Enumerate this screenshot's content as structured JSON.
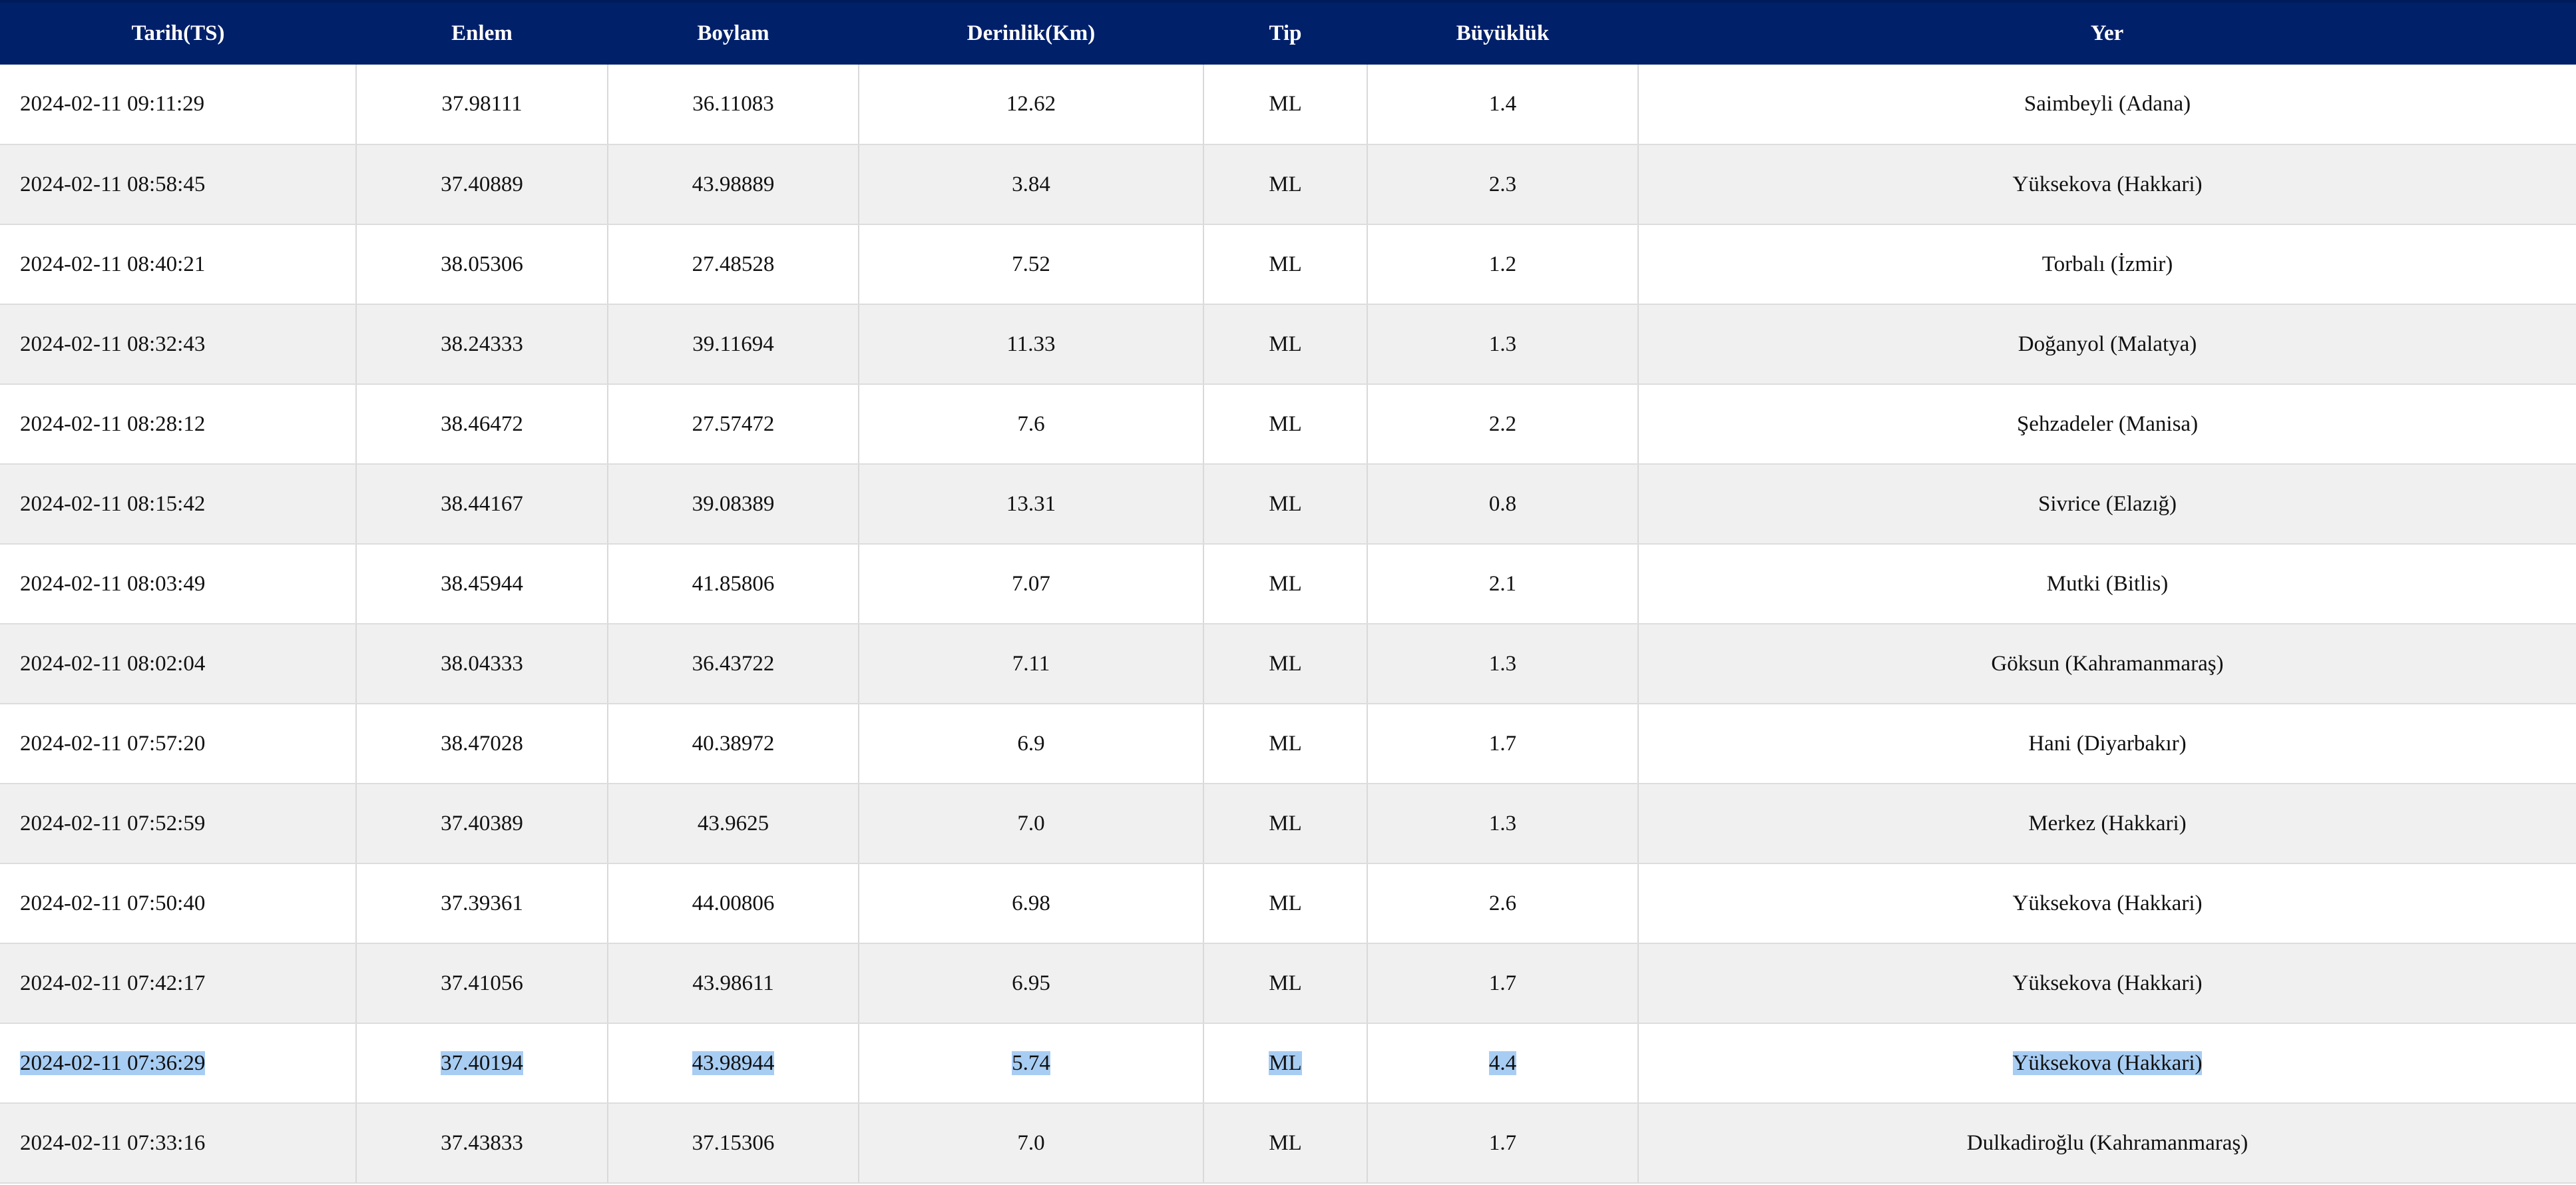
{
  "table": {
    "headers": [
      "Tarih(TS)",
      "Enlem",
      "Boylam",
      "Derinlik(Km)",
      "Tip",
      "Büyüklük",
      "Yer"
    ],
    "rows": [
      [
        "2024-02-11 09:11:29",
        "37.98111",
        "36.11083",
        "12.62",
        "ML",
        "1.4",
        "Saimbeyli (Adana)"
      ],
      [
        "2024-02-11 08:58:45",
        "37.40889",
        "43.98889",
        "3.84",
        "ML",
        "2.3",
        "Yüksekova (Hakkari)"
      ],
      [
        "2024-02-11 08:40:21",
        "38.05306",
        "27.48528",
        "7.52",
        "ML",
        "1.2",
        "Torbalı (İzmir)"
      ],
      [
        "2024-02-11 08:32:43",
        "38.24333",
        "39.11694",
        "11.33",
        "ML",
        "1.3",
        "Doğanyol (Malatya)"
      ],
      [
        "2024-02-11 08:28:12",
        "38.46472",
        "27.57472",
        "7.6",
        "ML",
        "2.2",
        "Şehzadeler (Manisa)"
      ],
      [
        "2024-02-11 08:15:42",
        "38.44167",
        "39.08389",
        "13.31",
        "ML",
        "0.8",
        "Sivrice (Elazığ)"
      ],
      [
        "2024-02-11 08:03:49",
        "38.45944",
        "41.85806",
        "7.07",
        "ML",
        "2.1",
        "Mutki (Bitlis)"
      ],
      [
        "2024-02-11 08:02:04",
        "38.04333",
        "36.43722",
        "7.11",
        "ML",
        "1.3",
        "Göksun (Kahramanmaraş)"
      ],
      [
        "2024-02-11 07:57:20",
        "38.47028",
        "40.38972",
        "6.9",
        "ML",
        "1.7",
        "Hani (Diyarbakır)"
      ],
      [
        "2024-02-11 07:52:59",
        "37.40389",
        "43.9625",
        "7.0",
        "ML",
        "1.3",
        "Merkez (Hakkari)"
      ],
      [
        "2024-02-11 07:50:40",
        "37.39361",
        "44.00806",
        "6.98",
        "ML",
        "2.6",
        "Yüksekova (Hakkari)"
      ],
      [
        "2024-02-11 07:42:17",
        "37.41056",
        "43.98611",
        "6.95",
        "ML",
        "1.7",
        "Yüksekova (Hakkari)"
      ],
      [
        "2024-02-11 07:36:29",
        "37.40194",
        "43.98944",
        "5.74",
        "ML",
        "4.4",
        "Yüksekova (Hakkari)"
      ],
      [
        "2024-02-11 07:33:16",
        "37.43833",
        "37.15306",
        "7.0",
        "ML",
        "1.7",
        "Dulkadiroğlu (Kahramanmaraş)"
      ]
    ],
    "selected_row": 12
  },
  "colors": {
    "header_bg": "#00206a",
    "header_text": "#ffffff",
    "row_stripe": "#f0f0f0",
    "selection": "#a8cdf3"
  }
}
